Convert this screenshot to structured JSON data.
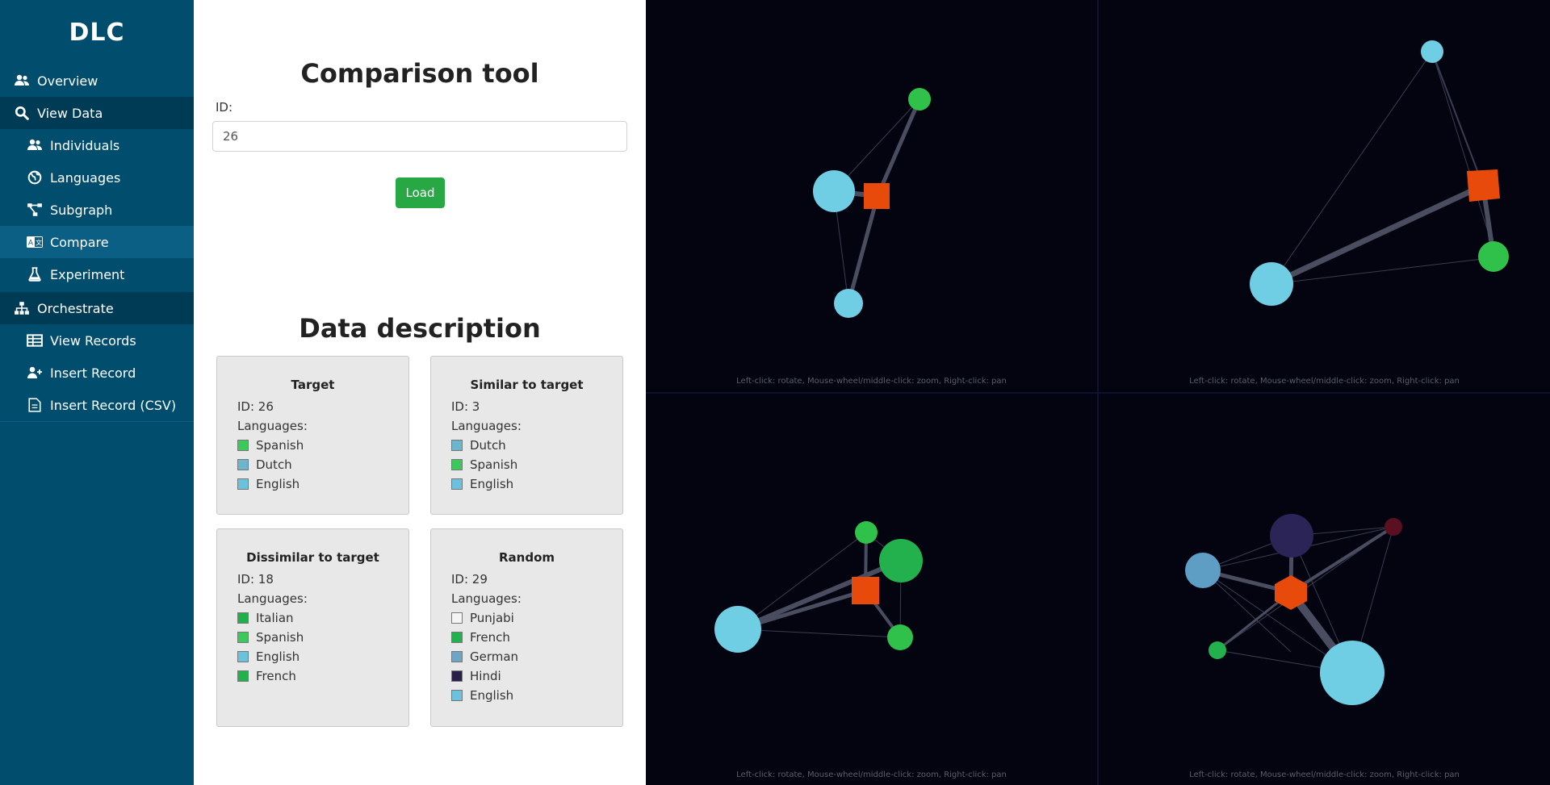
{
  "sidebar": {
    "brand": "DLC",
    "items": [
      {
        "label": "Overview",
        "icon": "users-icon",
        "type": "top"
      },
      {
        "label": "View Data",
        "icon": "search-icon",
        "type": "group"
      },
      {
        "label": "Individuals",
        "icon": "users-icon",
        "type": "sub"
      },
      {
        "label": "Languages",
        "icon": "globe-icon",
        "type": "sub"
      },
      {
        "label": "Subgraph",
        "icon": "project-diagram-icon",
        "type": "sub"
      },
      {
        "label": "Compare",
        "icon": "language-icon",
        "type": "sub",
        "active": true
      },
      {
        "label": "Experiment",
        "icon": "flask-icon",
        "type": "sub"
      },
      {
        "label": "Orchestrate",
        "icon": "sitemap-icon",
        "type": "group"
      },
      {
        "label": "View Records",
        "icon": "table-icon",
        "type": "sub"
      },
      {
        "label": "Insert Record",
        "icon": "user-plus-icon",
        "type": "sub"
      },
      {
        "label": "Insert Record (CSV)",
        "icon": "file-csv-icon",
        "type": "sub"
      }
    ]
  },
  "main": {
    "title": "Comparison tool",
    "id_label": "ID:",
    "id_value": "26",
    "load_label": "Load",
    "description_title": "Data description",
    "id_prefix": "ID: ",
    "languages_label": "Languages:",
    "cards": [
      {
        "title": "Target",
        "id": "26",
        "languages": [
          {
            "name": "Spanish",
            "color": "#3cc85a"
          },
          {
            "name": "Dutch",
            "color": "#6cb6cc"
          },
          {
            "name": "English",
            "color": "#6cc1dc"
          }
        ]
      },
      {
        "title": "Similar to target",
        "id": "3",
        "languages": [
          {
            "name": "Dutch",
            "color": "#6cb6cc"
          },
          {
            "name": "Spanish",
            "color": "#3cc85a"
          },
          {
            "name": "English",
            "color": "#6cc1dc"
          }
        ]
      },
      {
        "title": "Dissimilar to target",
        "id": "18",
        "languages": [
          {
            "name": "Italian",
            "color": "#1fb04a"
          },
          {
            "name": "Spanish",
            "color": "#3cc85a"
          },
          {
            "name": "English",
            "color": "#6cc1dc"
          },
          {
            "name": "French",
            "color": "#22b14c"
          }
        ]
      },
      {
        "title": "Random",
        "id": "29",
        "languages": [
          {
            "name": "Punjabi",
            "color": "#f4f4f4"
          },
          {
            "name": "French",
            "color": "#22b14c"
          },
          {
            "name": "German",
            "color": "#6ea4c4"
          },
          {
            "name": "Hindi",
            "color": "#2a1f4a"
          },
          {
            "name": "English",
            "color": "#6cc1dc"
          }
        ]
      }
    ]
  },
  "graphs": {
    "hint": "Left-click: rotate, Mouse-wheel/middle-click: zoom, Right-click: pan",
    "colors": {
      "target": "#e84a0c",
      "spanish": "#2fc14a",
      "english": "#71cfe6",
      "hindi": "#2b2457",
      "punjabi": "#5a1020",
      "german": "#5f9ec4"
    }
  }
}
